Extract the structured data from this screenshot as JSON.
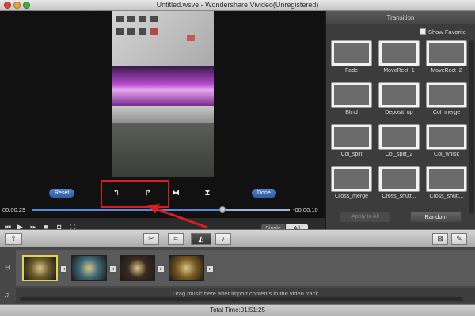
{
  "window": {
    "title": "Untitled.wsve - Wondershare Vivideo(Unregistered)"
  },
  "preview": {
    "reset_label": "Reset",
    "done_label": "Done",
    "time_current": "00:00:29",
    "time_remaining": "-00:00:10",
    "progress": 0.74,
    "view_modes": [
      "Single",
      "All"
    ],
    "selected_view_mode": "All"
  },
  "transition": {
    "title": "Transition",
    "show_favorite_label": "Show Favorite",
    "items": [
      {
        "label": "Fade",
        "icon": "fade-icon"
      },
      {
        "label": "MoveRect_1",
        "icon": "move-rect-icon"
      },
      {
        "label": "MoveRect_2",
        "icon": "move-rect-icon"
      },
      {
        "label": "Blind",
        "icon": "blind-icon"
      },
      {
        "label": "Deposit_up",
        "icon": "deposit-up-icon"
      },
      {
        "label": "Col_merge",
        "icon": "col-merge-icon"
      },
      {
        "label": "Col_split",
        "icon": "col-split-icon"
      },
      {
        "label": "Col_split_2",
        "icon": "col-split-icon"
      },
      {
        "label": "Col_whisk",
        "icon": "col-whisk-icon"
      },
      {
        "label": "Cross_merge",
        "icon": "cross-merge-icon"
      },
      {
        "label": "Cross_shutt...",
        "icon": "cross-shutter-icon"
      },
      {
        "label": "Cross_shutt...",
        "icon": "cross-shutter-icon"
      }
    ],
    "apply_all_label": "Apply to All",
    "random_label": "Random"
  },
  "timeline": {
    "drag_hint": "Drag music here after import contents in the video track",
    "clip_colors": [
      "#6b5a2c",
      "#3f6a78",
      "#3a2a20",
      "#7a5a20"
    ]
  },
  "status": {
    "total_time": "Total Time:01:51:25"
  },
  "colors": {
    "highlight": "#d81e1e",
    "accent": "#2d5ea6"
  }
}
